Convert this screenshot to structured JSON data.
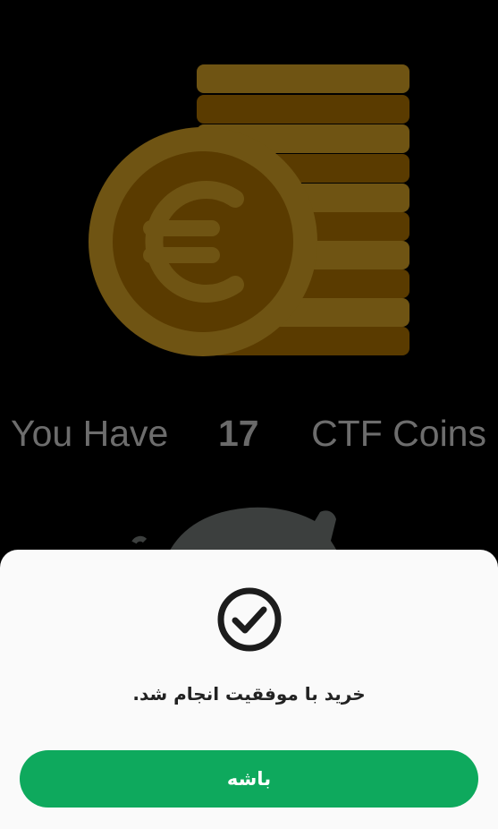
{
  "balance": {
    "prefix": "You Have",
    "count": "17",
    "suffix": "CTF Coins"
  },
  "illustration": {
    "icon": "euro-coin-stack-icon",
    "coin_color": "#6b4a0f",
    "stack_colors": [
      "#6f5413",
      "#5a3b00"
    ]
  },
  "dialog": {
    "icon": "check-circle-icon",
    "message": "خرید با موفقیت انجام شد.",
    "ok_label": "باشه",
    "button_color": "#0ea95d"
  }
}
